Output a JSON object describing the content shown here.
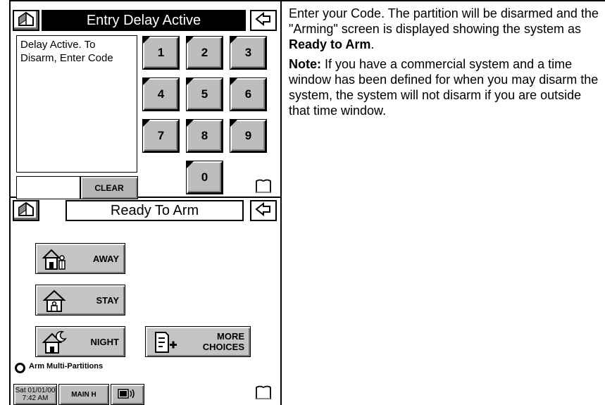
{
  "entry_screen": {
    "title": "Entry Delay Active",
    "message": "Delay Active. To Disarm, Enter Code",
    "keypad": [
      "1",
      "2",
      "3",
      "4",
      "5",
      "6",
      "7",
      "8",
      "9",
      "0"
    ],
    "clear_label": "CLEAR",
    "code_value": ""
  },
  "arm_screen": {
    "title": "Ready To Arm",
    "away_label": "AWAY",
    "stay_label": "STAY",
    "night_label": "NIGHT",
    "more_line1": "MORE",
    "more_line2": "CHOICES",
    "multi_partition_label": "Arm Multi-Partitions",
    "date": "Sat 01/01/00",
    "time": "7:42 AM",
    "main_label": "MAIN H"
  },
  "instructions": {
    "p1_pre": "Enter your Code. The partition will be disarmed and the \"Arming\" screen is displayed showing the system as ",
    "p1_bold": "Ready to Arm",
    "p1_post": ".",
    "note_label": "Note:",
    "note_text": " If you have a commercial system and a time window has been defined for when you may disarm the system, the system will not disarm if you are outside that time window."
  },
  "icons": [
    "house-icon",
    "back-arrow-icon",
    "shield-icon",
    "away-house-icon",
    "stay-house-icon",
    "night-house-icon",
    "more-choices-icon",
    "speaker-icon"
  ]
}
